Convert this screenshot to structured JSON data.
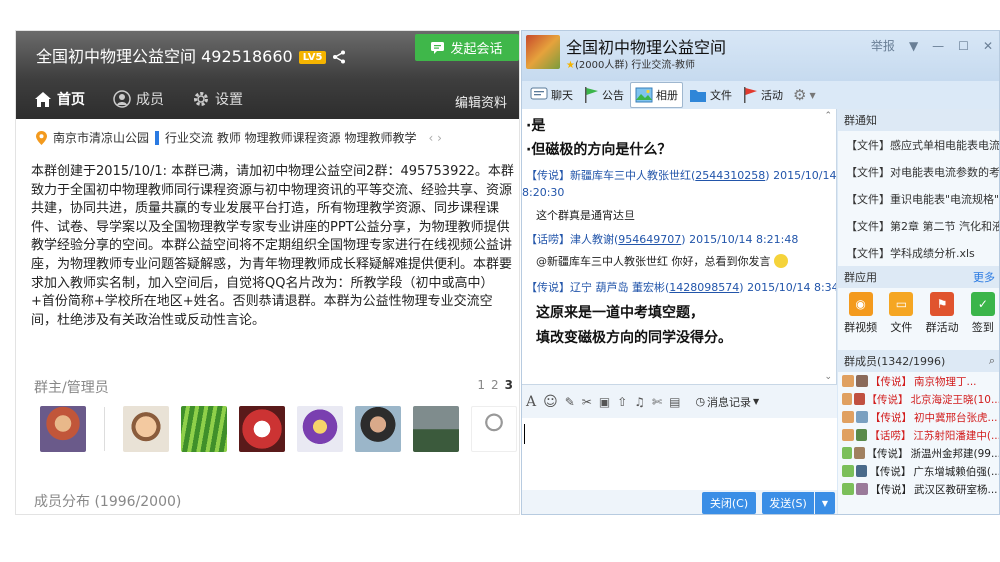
{
  "left": {
    "title": "全国初中物理公益空间 492518660",
    "level_badge": "LV5",
    "start_chat": "发起会话",
    "nav": [
      {
        "label": "首页",
        "icon": "home-icon"
      },
      {
        "label": "成员",
        "icon": "user-icon"
      },
      {
        "label": "设置",
        "icon": "gear-icon"
      }
    ],
    "edit_info": "编辑资料",
    "location": "南京市清凉山公园",
    "tags_text": "行业交流  教师  物理教师课程资源  物理教师教学",
    "pager_arrows": "‹  ›",
    "description": "本群创建于2015/10/1: 本群已满，请加初中物理公益空间2群：495753922。本群致力于全国初中物理教师同行课程资源与初中物理资讯的平等交流、经验共享、资源共建，协同共进，质量共赢的专业发展平台打造，所有物理教学资源、同步课程课件、试卷、导学案以及全国物理教学专家专业讲座的PPT公益分享，为物理教师提供教学经验分享的空间。本群公益空间将不定期组织全国物理专家进行在线视频公益讲座，为物理教师专业问题答疑解惑，为青年物理教师成长释疑解难提供便利。本群要求加入教师实名制，加入空间后，自觉将QQ名片改为：所教学段（初中或高中）+首份简称+学校所在地区+姓名。否则恭请退群。本群为公益性物理专业交流空间，杜绝涉及有关政治性或反动性言论。",
    "admin_label": "群主/管理员",
    "pager": [
      "1",
      "2",
      "3"
    ],
    "distribution_label": "成员分布 (1996/2000)"
  },
  "right": {
    "title": "全国初中物理公益空间",
    "subtitle": "(2000人群) 行业交流-教师",
    "report": "举报",
    "tabs": [
      {
        "label": "聊天",
        "icon": "chat-icon"
      },
      {
        "label": "公告",
        "icon": "flag-icon"
      },
      {
        "label": "相册",
        "icon": "photo-icon"
      },
      {
        "label": "文件",
        "icon": "folder-icon"
      },
      {
        "label": "活动",
        "icon": "activity-flag-icon"
      }
    ],
    "chat": {
      "line1": "·是",
      "line2": "·但磁极的方向是什么？",
      "msg1_header_prefix": "【传说】新疆库车三中人教张世红(",
      "msg1_qq": "2544310258",
      "msg1_header_suffix": ") 2015/10/14",
      "msg1_time": "8:20:30",
      "msg1_text": "这个群真是通宵达旦",
      "msg2_header_prefix": "【话唠】津人教谢(",
      "msg2_qq": "954649707",
      "msg2_header_suffix": ") 2015/10/14 8:21:48",
      "msg2_text": "@新疆库车三中人教张世红 你好，总看到你发言",
      "msg3_header_prefix": "【传说】辽宁 葫芦岛 董宏彬(",
      "msg3_qq": "1428098574",
      "msg3_header_suffix": ") 2015/10/14 8:34:53",
      "msg3_line1": "这原来是一道中考填空题，",
      "msg3_line2": "填改变磁极方向的同学没得分。"
    },
    "history_label": "消息记录",
    "close_btn": "关闭(C)",
    "send_btn": "发送(S)",
    "notices_header": "群通知",
    "notices": [
      "【文件】感应式单相电能表电流参...",
      "【文件】对电能表电流参数的考查...",
      "【文件】重识电能表\"电流规格\"的...",
      "【文件】第2章 第二节 汽化和液化...",
      "【文件】学科成绩分析.xls"
    ],
    "apps_header": "群应用",
    "apps_more": "更多",
    "apps": [
      {
        "label": "群视频",
        "color": "#f39a1e"
      },
      {
        "label": "文件",
        "color": "#f5a623"
      },
      {
        "label": "群活动",
        "color": "#e0542e"
      },
      {
        "label": "签到",
        "color": "#3bb54a"
      }
    ],
    "members_header": "群成员(1342/1996)",
    "members": [
      {
        "tag": "【传说】",
        "name": "南京物理丁...",
        "color": "red"
      },
      {
        "tag": "【传说】",
        "name": "北京海淀王晓(10...",
        "color": "red"
      },
      {
        "tag": "【传说】",
        "name": "初中冀邢台张虎...",
        "color": "red"
      },
      {
        "tag": "【话唠】",
        "name": "江苏射阳潘建中(...",
        "color": "red"
      },
      {
        "tag": "【传说】",
        "name": "浙温州金邦建(99...",
        "color": "dark"
      },
      {
        "tag": "【传说】",
        "name": "广东增城赖伯强(...",
        "color": "dark"
      },
      {
        "tag": "【传说】",
        "name": "武汉区教研室杨...",
        "color": "dark"
      }
    ]
  }
}
